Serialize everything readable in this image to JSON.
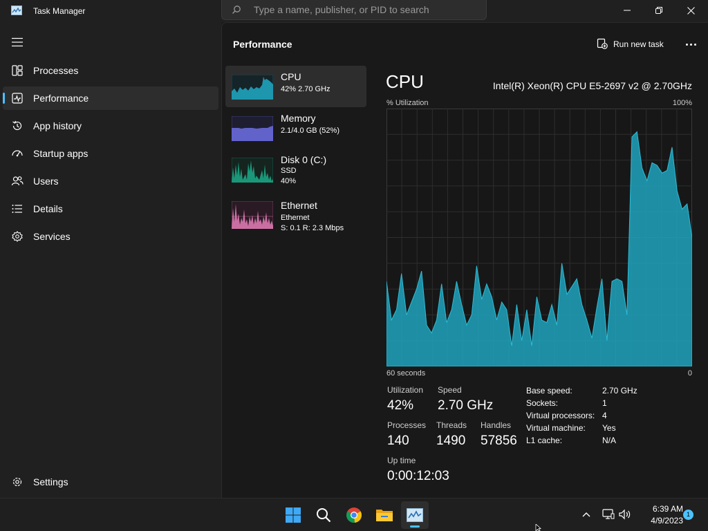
{
  "window": {
    "title": "Task Manager",
    "search_placeholder": "Type a name, publisher, or PID to search",
    "icons": {
      "app": "task-manager-icon",
      "minimize": "minimize-icon",
      "maximize": "restore-icon",
      "close": "close-icon"
    }
  },
  "sidebar": {
    "items": [
      {
        "label": "Processes",
        "icon": "processes-icon"
      },
      {
        "label": "Performance",
        "icon": "performance-icon",
        "active": true
      },
      {
        "label": "App history",
        "icon": "history-icon"
      },
      {
        "label": "Startup apps",
        "icon": "startup-icon"
      },
      {
        "label": "Users",
        "icon": "users-icon"
      },
      {
        "label": "Details",
        "icon": "details-icon"
      },
      {
        "label": "Services",
        "icon": "services-icon"
      }
    ],
    "settings_label": "Settings"
  },
  "header": {
    "title": "Performance",
    "run_task_label": "Run new task"
  },
  "resources": [
    {
      "name": "CPU",
      "lines": [
        "42%  2.70 GHz"
      ],
      "color": "#17a2b8",
      "selected": true
    },
    {
      "name": "Memory",
      "lines": [
        "2.1/4.0 GB (52%)"
      ],
      "color": "#6e6ee6"
    },
    {
      "name": "Disk 0 (C:)",
      "lines": [
        "SSD",
        "40%"
      ],
      "color": "#1bab8a"
    },
    {
      "name": "Ethernet",
      "lines": [
        "Ethernet",
        "S: 0.1  R: 2.3 Mbps"
      ],
      "color": "#e77fb8"
    }
  ],
  "detail": {
    "title": "CPU",
    "model": "Intel(R) Xeon(R) CPU E5-2697 v2 @ 2.70GHz",
    "util_label": "% Utilization",
    "max_label": "100%",
    "time_label": "60 seconds",
    "zero_label": "0",
    "stats": {
      "utilization_label": "Utilization",
      "utilization": "42%",
      "speed_label": "Speed",
      "speed": "2.70 GHz",
      "processes_label": "Processes",
      "processes": "140",
      "threads_label": "Threads",
      "threads": "1490",
      "handles_label": "Handles",
      "handles": "57856",
      "uptime_label": "Up time",
      "uptime": "0:00:12:03"
    },
    "specs": [
      {
        "key": "Base speed:",
        "value": "2.70 GHz"
      },
      {
        "key": "Sockets:",
        "value": "1"
      },
      {
        "key": "Virtual processors:",
        "value": "4"
      },
      {
        "key": "Virtual machine:",
        "value": "Yes"
      },
      {
        "key": "L1 cache:",
        "value": "N/A"
      }
    ]
  },
  "cpu_graph": {
    "color": "#1fa3bd",
    "values": [
      33,
      18,
      22,
      36,
      20,
      25,
      30,
      37,
      16,
      13,
      18,
      32,
      17,
      22,
      33,
      24,
      16,
      20,
      39,
      26,
      32,
      27,
      18,
      25,
      22,
      8,
      24,
      10,
      22,
      8,
      27,
      18,
      17,
      24,
      16,
      40,
      28,
      31,
      34,
      24,
      18,
      11,
      23,
      34,
      10,
      33,
      34,
      33,
      20,
      89,
      91,
      77,
      72,
      79,
      78,
      75,
      76,
      85,
      68,
      61,
      63,
      50
    ]
  },
  "taskbar": {
    "apps": [
      "start-icon",
      "search-icon",
      "chrome-icon",
      "file-explorer-icon",
      "task-manager-icon"
    ],
    "time": "6:39 AM",
    "date": "4/9/2023",
    "notifications": "1"
  }
}
